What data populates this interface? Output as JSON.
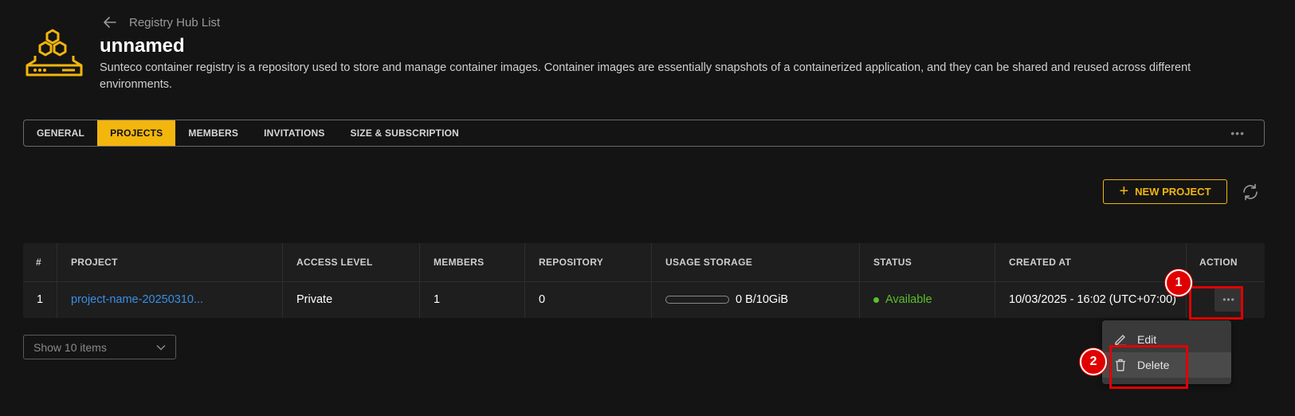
{
  "colors": {
    "accent": "#f2b60d",
    "link": "#3a8ee6",
    "status_ok": "#5bbf2a",
    "annotation": "#e00000",
    "background": "#141414"
  },
  "header": {
    "back_label": "Registry Hub List",
    "title": "unnamed",
    "description": "Sunteco container registry is a repository used to store and manage container images. Container images are essentially snapshots of a containerized application, and they can be shared and reused across different environments.",
    "logo_icon": "registry-hive-icon"
  },
  "tabs": [
    {
      "label": "GENERAL",
      "active": false
    },
    {
      "label": "PROJECTS",
      "active": true
    },
    {
      "label": "MEMBERS",
      "active": false
    },
    {
      "label": "INVITATIONS",
      "active": false
    },
    {
      "label": "SIZE & SUBSCRIPTION",
      "active": false
    }
  ],
  "tabs_more": "•••",
  "toolbar": {
    "new_project_label": "NEW PROJECT",
    "refresh_icon": "refresh-icon"
  },
  "table": {
    "columns": [
      "#",
      "PROJECT",
      "ACCESS LEVEL",
      "MEMBERS",
      "REPOSITORY",
      "USAGE STORAGE",
      "STATUS",
      "CREATED AT",
      "ACTION"
    ],
    "rows": [
      {
        "index": "1",
        "project": "project-name-20250310...",
        "access_level": "Private",
        "members": "1",
        "repository": "0",
        "usage_storage": "0 B/10GiB",
        "usage_fraction": 0,
        "status": "Available",
        "created_at": "10/03/2025 - 16:02 (UTC+07:00)",
        "action": "•••"
      }
    ]
  },
  "pagination": {
    "show_items": "Show 10 items"
  },
  "action_menu": {
    "edit_label": "Edit",
    "delete_label": "Delete"
  },
  "annotations": {
    "step1": "1",
    "step2": "2"
  }
}
